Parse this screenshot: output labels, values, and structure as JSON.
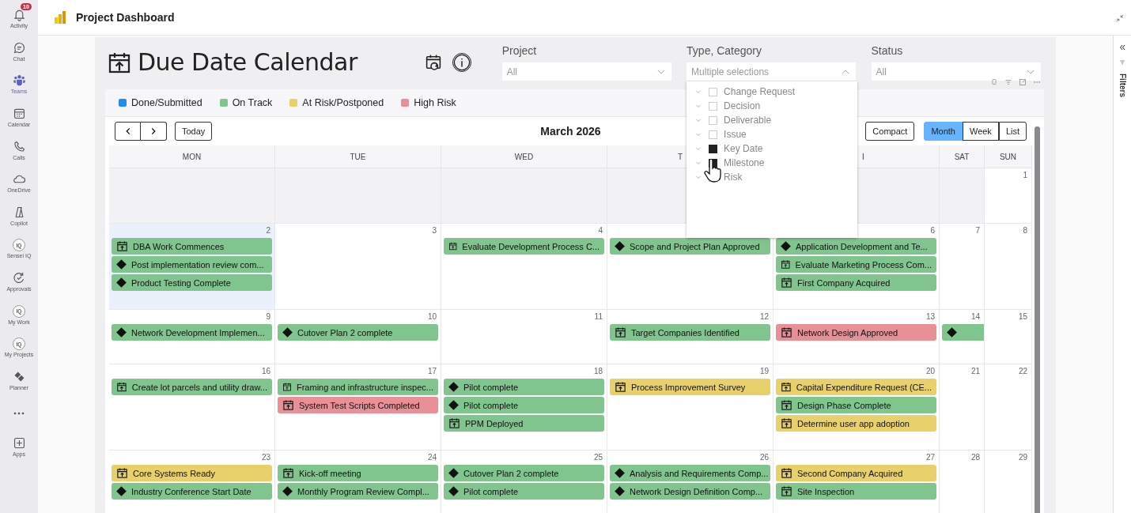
{
  "rail": [
    {
      "label": "Activity",
      "badge": "10",
      "selected": false
    },
    {
      "label": "Chat",
      "selected": false
    },
    {
      "label": "Teams",
      "selected": true
    },
    {
      "label": "Calendar",
      "selected": false
    },
    {
      "label": "Calls",
      "selected": false
    },
    {
      "label": "OneDrive",
      "selected": false
    },
    {
      "label": "Copilot",
      "selected": false
    },
    {
      "label": "Sensei IQ",
      "icon_text": "IQ",
      "selected": false
    },
    {
      "label": "Approvals",
      "selected": false
    },
    {
      "label": "My Work",
      "icon_text": "IQ",
      "selected": false
    },
    {
      "label": "My Projects",
      "icon_text": "IQ",
      "selected": false
    },
    {
      "label": "Planner",
      "selected": false
    },
    {
      "kind": "more",
      "selected": false
    },
    {
      "label": "Apps",
      "selected": false
    }
  ],
  "app": {
    "title": "Project Dashboard"
  },
  "filters_pane": {
    "label": "Filters"
  },
  "report": {
    "title": "Due Date Calendar",
    "slicers": [
      {
        "label": "Project",
        "value": "All",
        "expanded": false
      },
      {
        "label": "Type, Category",
        "value": "Multiple selections",
        "expanded": true,
        "options": [
          {
            "label": "Change Request",
            "checked": false
          },
          {
            "label": "Decision",
            "checked": false
          },
          {
            "label": "Deliverable",
            "checked": false
          },
          {
            "label": "Issue",
            "checked": false
          },
          {
            "label": "Key Date",
            "checked": true
          },
          {
            "label": "Milestone",
            "checked": true
          },
          {
            "label": "Risk",
            "checked": false
          }
        ]
      },
      {
        "label": "Status",
        "value": "All",
        "expanded": false
      }
    ],
    "legend": [
      {
        "label": "Done/Submitted",
        "color": "#1f8ef1"
      },
      {
        "label": "On Track",
        "color": "#80c58e"
      },
      {
        "label": "At Risk/Postponed",
        "color": "#e8d06a"
      },
      {
        "label": "High Risk",
        "color": "#e88f98"
      }
    ],
    "toolbar": {
      "today": "Today",
      "month_title": "March 2026",
      "compact": "Compact",
      "views": [
        {
          "label": "Month",
          "selected": true
        },
        {
          "label": "Week",
          "selected": false
        },
        {
          "label": "List",
          "selected": false
        }
      ]
    },
    "weekdays": [
      "MON",
      "TUE",
      "WED",
      "T",
      "I",
      "SAT",
      "SUN"
    ],
    "weeks": [
      {
        "days": [
          {
            "other_month": true,
            "today": false
          },
          {
            "other_month": true,
            "today": false
          },
          {
            "other_month": true,
            "today": false
          },
          {
            "other_month": true,
            "today": false
          },
          {
            "other_month": true,
            "today": false
          },
          {
            "other_month": true,
            "today": false
          },
          {
            "day": "1",
            "other_month": false,
            "today": false
          }
        ]
      },
      {
        "days": [
          {
            "day": "2",
            "other_month": false,
            "today": true,
            "events": [
              {
                "kind": "document",
                "title": "DBA Work Commences",
                "color": "#80c58e"
              },
              {
                "kind": "milestone",
                "title": "Post implementation review com...",
                "color": "#80c58e"
              },
              {
                "kind": "milestone",
                "title": "Product Testing Complete",
                "color": "#80c58e"
              }
            ]
          },
          {
            "day": "3",
            "other_month": false,
            "today": false
          },
          {
            "day": "4",
            "other_month": false,
            "today": false,
            "events": [
              {
                "kind": "document",
                "title": "Evaluate Development Process C...",
                "color": "#80c58e"
              }
            ]
          },
          {
            "other_month": false,
            "today": false,
            "events": [
              {
                "kind": "milestone",
                "title": "Scope and Project Plan Approved",
                "color": "#80c58e"
              }
            ]
          },
          {
            "day": "6",
            "other_month": false,
            "today": false,
            "events": [
              {
                "kind": "milestone",
                "title": "Application Development and Te...",
                "color": "#80c58e"
              },
              {
                "kind": "document",
                "title": "Evaluate Marketing Process Com...",
                "color": "#80c58e"
              },
              {
                "kind": "document",
                "title": "First Company Acquired",
                "color": "#80c58e"
              }
            ]
          },
          {
            "day": "7",
            "other_month": false,
            "today": false
          },
          {
            "day": "8",
            "other_month": false,
            "today": false
          }
        ]
      },
      {
        "days": [
          {
            "day": "9",
            "other_month": false,
            "today": false,
            "events": [
              {
                "kind": "milestone",
                "title": "Network Development Implemen...",
                "color": "#80c58e"
              }
            ]
          },
          {
            "day": "10",
            "other_month": false,
            "today": false,
            "events": [
              {
                "kind": "milestone",
                "title": "Cutover Plan 2 complete",
                "color": "#80c58e"
              }
            ]
          },
          {
            "day": "11",
            "other_month": false,
            "today": false
          },
          {
            "day": "12",
            "other_month": false,
            "today": false,
            "events": [
              {
                "kind": "document",
                "title": "Target Companies Identified",
                "color": "#80c58e"
              }
            ]
          },
          {
            "day": "13",
            "other_month": false,
            "today": false,
            "events": [
              {
                "kind": "document",
                "title": "Network Design Approved",
                "color": "#e88f98"
              }
            ]
          },
          {
            "day": "14",
            "other_month": false,
            "today": false,
            "events": [
              {
                "kind": "milestone",
                "color": "#80c58e"
              }
            ]
          },
          {
            "day": "15",
            "other_month": false,
            "today": false
          }
        ]
      },
      {
        "days": [
          {
            "day": "16",
            "other_month": false,
            "today": false,
            "events": [
              {
                "kind": "document",
                "title": "Create lot parcels and utility draw...",
                "color": "#80c58e"
              }
            ]
          },
          {
            "day": "17",
            "other_month": false,
            "today": false,
            "events": [
              {
                "kind": "document",
                "title": "Framing and infrastructure inspec...",
                "color": "#80c58e"
              },
              {
                "kind": "document",
                "title": "System Test Scripts Completed",
                "color": "#e88f98"
              }
            ]
          },
          {
            "day": "18",
            "other_month": false,
            "today": false,
            "events": [
              {
                "kind": "milestone",
                "title": "Pilot complete",
                "color": "#80c58e"
              },
              {
                "kind": "milestone",
                "title": "Pilot complete",
                "color": "#80c58e"
              },
              {
                "kind": "document",
                "title": "PPM Deployed",
                "color": "#80c58e"
              }
            ]
          },
          {
            "day": "19",
            "other_month": false,
            "today": false,
            "events": [
              {
                "kind": "document",
                "title": "Process Improvement Survey",
                "color": "#e8d06a"
              }
            ]
          },
          {
            "day": "20",
            "other_month": false,
            "today": false,
            "events": [
              {
                "kind": "document",
                "title": "Capital Expenditure Request (CE...",
                "color": "#e8d06a"
              },
              {
                "kind": "document",
                "title": "Design Phase Complete",
                "color": "#80c58e"
              },
              {
                "kind": "document",
                "title": "Determine user app adoption",
                "color": "#e8d06a"
              }
            ]
          },
          {
            "day": "21",
            "other_month": false,
            "today": false
          },
          {
            "day": "22",
            "other_month": false,
            "today": false
          }
        ]
      },
      {
        "days": [
          {
            "day": "23",
            "other_month": false,
            "today": false,
            "events": [
              {
                "kind": "document",
                "title": "Core Systems Ready",
                "color": "#e8d06a"
              },
              {
                "kind": "milestone",
                "title": "Industry Conference Start Date",
                "color": "#80c58e"
              }
            ]
          },
          {
            "day": "24",
            "other_month": false,
            "today": false,
            "events": [
              {
                "kind": "document",
                "title": "Kick-off meeting",
                "color": "#80c58e"
              },
              {
                "kind": "milestone",
                "title": "Monthly Program Review Compl...",
                "color": "#80c58e"
              }
            ]
          },
          {
            "day": "25",
            "other_month": false,
            "today": false,
            "events": [
              {
                "kind": "milestone",
                "title": "Cutover Plan 2 complete",
                "color": "#80c58e"
              },
              {
                "kind": "milestone",
                "title": "Pilot complete",
                "color": "#80c58e"
              }
            ]
          },
          {
            "day": "26",
            "other_month": false,
            "today": false,
            "events": [
              {
                "kind": "milestone",
                "title": "Analysis and Requirements Comp...",
                "color": "#80c58e"
              },
              {
                "kind": "milestone",
                "title": "Network Design Definition Comp...",
                "color": "#80c58e"
              }
            ]
          },
          {
            "day": "27",
            "other_month": false,
            "today": false,
            "events": [
              {
                "kind": "document",
                "title": "Second Company Acquired",
                "color": "#e8d06a"
              },
              {
                "kind": "document",
                "title": "Site Inspection",
                "color": "#80c58e"
              }
            ]
          },
          {
            "day": "28",
            "other_month": false,
            "today": false
          },
          {
            "day": "29",
            "other_month": false,
            "today": false
          }
        ]
      }
    ]
  }
}
